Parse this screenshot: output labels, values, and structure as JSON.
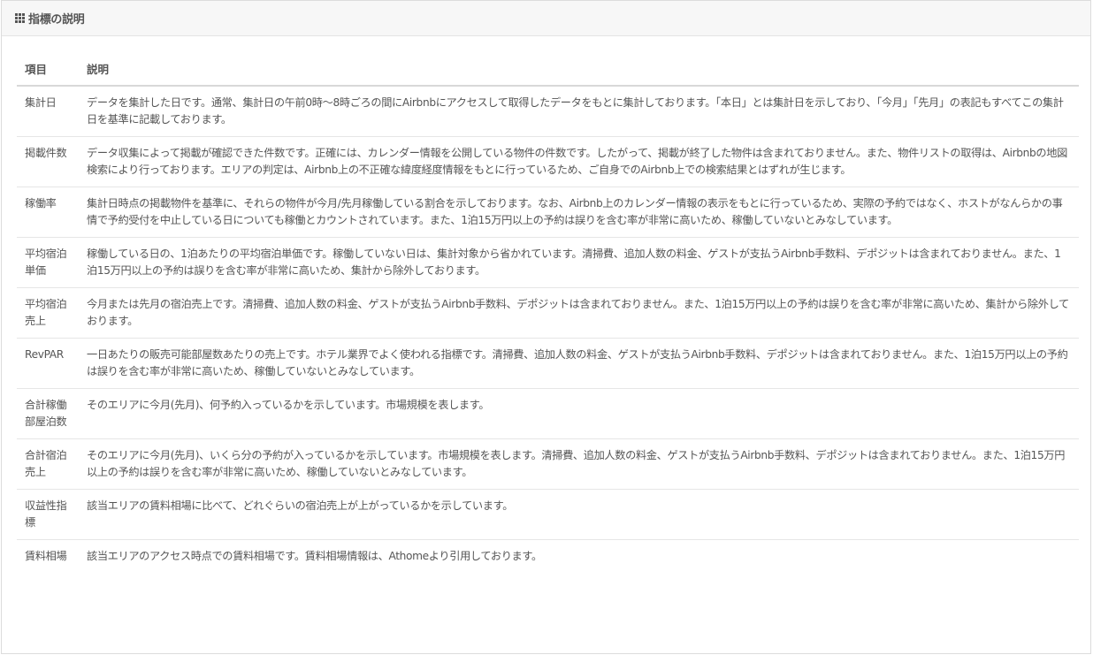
{
  "panel": {
    "icon": "grid-icon",
    "title": "指標の説明"
  },
  "table": {
    "headers": [
      "項目",
      "説明"
    ],
    "rows": [
      {
        "item": "集計日",
        "desc": "データを集計した日です。通常、集計日の午前0時〜8時ごろの間にAirbnbにアクセスして取得したデータをもとに集計しております。「本日」とは集計日を示しており、「今月」「先月」の表記もすべてこの集計日を基準に記載しております。"
      },
      {
        "item": "掲載件数",
        "desc": "データ収集によって掲載が確認できた件数です。正確には、カレンダー情報を公開している物件の件数です。したがって、掲載が終了した物件は含まれておりません。また、物件リストの取得は、Airbnbの地図検索により行っております。エリアの判定は、Airbnb上の不正確な緯度経度情報をもとに行っているため、ご自身でのAirbnb上での検索結果とはずれが生じます。"
      },
      {
        "item": "稼働率",
        "desc": "集計日時点の掲載物件を基準に、それらの物件が今月/先月稼働している割合を示しております。なお、Airbnb上のカレンダー情報の表示をもとに行っているため、実際の予約ではなく、ホストがなんらかの事情で予約受付を中止している日についても稼働とカウントされています。また、1泊15万円以上の予約は誤りを含む率が非常に高いため、稼働していないとみなしています。"
      },
      {
        "item": "平均宿泊単価",
        "desc": "稼働している日の、1泊あたりの平均宿泊単価です。稼働していない日は、集計対象から省かれています。清掃費、追加人数の料金、ゲストが支払うAirbnb手数料、デポジットは含まれておりません。また、1泊15万円以上の予約は誤りを含む率が非常に高いため、集計から除外しております。"
      },
      {
        "item": "平均宿泊売上",
        "desc": "今月または先月の宿泊売上です。清掃費、追加人数の料金、ゲストが支払うAirbnb手数料、デポジットは含まれておりません。また、1泊15万円以上の予約は誤りを含む率が非常に高いため、集計から除外しております。"
      },
      {
        "item": "RevPAR",
        "desc": "一日あたりの販売可能部屋数あたりの売上です。ホテル業界でよく使われる指標です。清掃費、追加人数の料金、ゲストが支払うAirbnb手数料、デポジットは含まれておりません。また、1泊15万円以上の予約は誤りを含む率が非常に高いため、稼働していないとみなしています。"
      },
      {
        "item": "合計稼働部屋泊数",
        "desc": "そのエリアに今月(先月)、何予約入っているかを示しています。市場規模を表します。"
      },
      {
        "item": "合計宿泊売上",
        "desc": "そのエリアに今月(先月)、いくら分の予約が入っているかを示しています。市場規模を表します。清掃費、追加人数の料金、ゲストが支払うAirbnb手数料、デポジットは含まれておりません。また、1泊15万円以上の予約は誤りを含む率が非常に高いため、稼働していないとみなしています。"
      },
      {
        "item": "収益性指標",
        "desc": "該当エリアの賃料相場に比べて、どれぐらいの宿泊売上が上がっているかを示しています。"
      },
      {
        "item": "賃料相場",
        "desc": "該当エリアのアクセス時点での賃料相場です。賃料相場情報は、Athomeより引用しております。"
      }
    ]
  }
}
